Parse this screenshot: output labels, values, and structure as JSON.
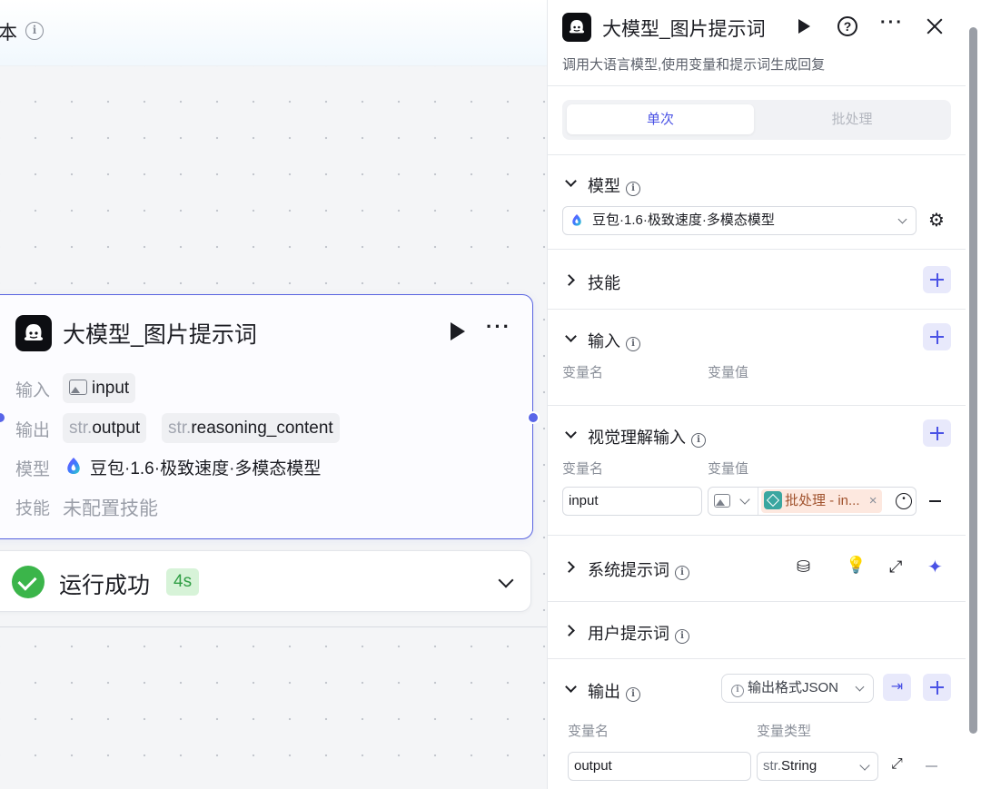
{
  "canvas": {
    "title_partial": "本",
    "node": {
      "title": "大模型_图片提示词",
      "input_label": "输入",
      "output_label": "输出",
      "model_label": "模型",
      "skill_label": "技能",
      "input_var": "input",
      "output_vars": [
        {
          "type": "str.",
          "name": "output"
        },
        {
          "type": "str.",
          "name": "reasoning_content"
        }
      ],
      "model_name": "豆包·1.6·极致速度·多模态模型",
      "skill_value": "未配置技能"
    },
    "status": {
      "text": "运行成功",
      "duration": "4s"
    }
  },
  "panel": {
    "title": "大模型_图片提示词",
    "subtitle": "调用大语言模型,使用变量和提示词生成回复",
    "tabs": [
      {
        "label": "单次",
        "active": true
      },
      {
        "label": "批处理",
        "active": false
      }
    ],
    "model_section": {
      "title": "模型",
      "selected": "豆包·1.6·极致速度·多模态模型"
    },
    "skill_section": {
      "title": "技能"
    },
    "input_section": {
      "title": "输入",
      "col_name": "变量名",
      "col_value": "变量值"
    },
    "vision_section": {
      "title": "视觉理解输入",
      "col_name": "变量名",
      "col_value": "变量值",
      "row": {
        "name": "input",
        "ref_label": "批处理 - in...",
        "ref_close": "×"
      }
    },
    "system_prompt_section": {
      "title": "系统提示词"
    },
    "user_prompt_section": {
      "title": "用户提示词"
    },
    "output_section": {
      "title": "输出",
      "format_button": "输出格式JSON",
      "col_name": "变量名",
      "col_type": "变量类型",
      "row": {
        "name": "output",
        "type_prefix": "str.",
        "type": "String"
      }
    }
  },
  "colors": {
    "accent": "#4a52e5",
    "success": "#3bb54a",
    "node_border": "#5863e0"
  }
}
